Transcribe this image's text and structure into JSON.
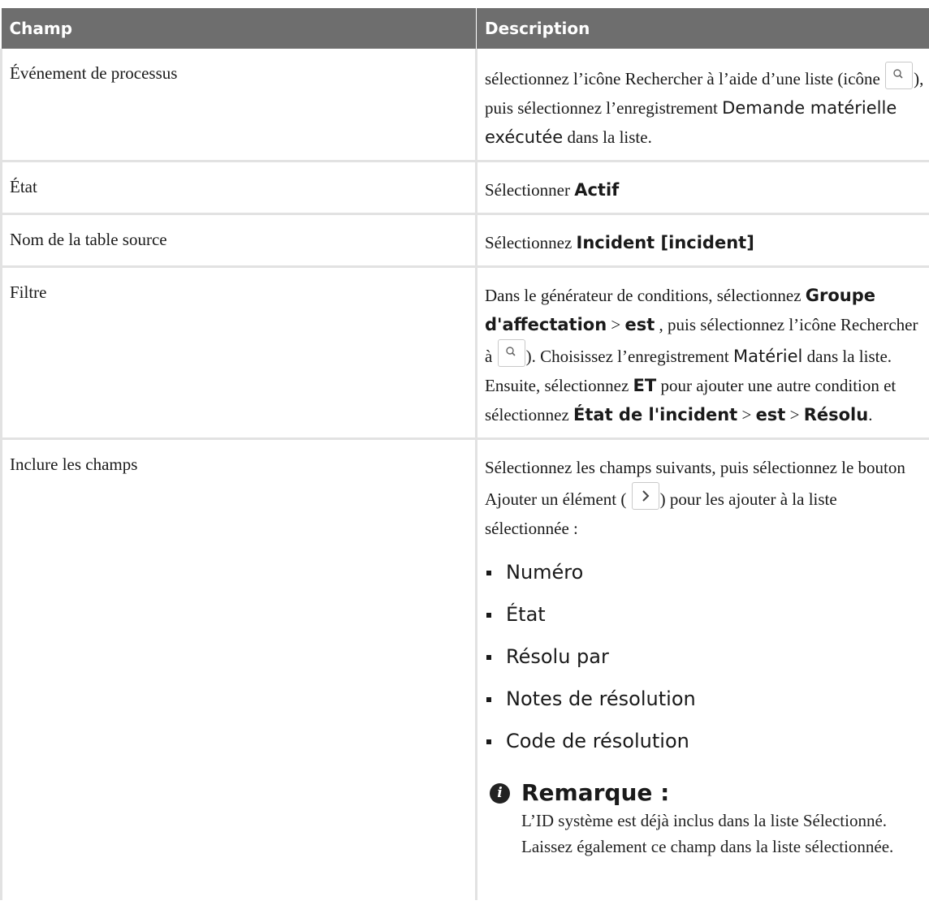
{
  "table": {
    "headers": [
      "Champ",
      "Description"
    ],
    "rows": {
      "process_event": {
        "field": "Événement de processus",
        "d1": "sélectionnez l’icône Rechercher à l’aide d’une liste (icône ",
        "d2": "), puis sélectionnez l’enregistrement ",
        "d3": "Demande matérielle exécutée",
        "d4": " dans la liste."
      },
      "state": {
        "field": "État",
        "d1": "Sélectionner ",
        "d2": "Actif"
      },
      "source_table": {
        "field": "Nom de la table source",
        "d1": "Sélectionnez ",
        "d2": "Incident [incident]"
      },
      "filter": {
        "field": "Filtre",
        "d1": "Dans le générateur de conditions, sélectionnez ",
        "d2": "Groupe d'affectation",
        "d3": " > ",
        "d4": "est",
        "d5": " , puis sélectionnez l’icône Rechercher à ",
        "d6": "). Choisissez l’enregistrement ",
        "d7": "Matériel",
        "d8": " dans la liste. Ensuite, sélectionnez ",
        "d9": "ET",
        "d10": " pour ajouter une autre condition et sélectionnez ",
        "d11": "État de l'incident",
        "d12": " > ",
        "d13": "est",
        "d14": " > ",
        "d15": "Résolu",
        "d16": "."
      },
      "include_fields": {
        "field": "Inclure les champs",
        "d1": "Sélectionnez les champs suivants, puis sélectionnez le bouton Ajouter un élément ( ",
        "d2": ") pour les ajouter à la liste sélectionnée :",
        "items": [
          "Numéro",
          "État",
          "Résolu par",
          "Notes de résolution",
          "Code de résolution"
        ],
        "note_title": "Remarque :",
        "note_body": "L’ID système est déjà inclus dans la liste Sélectionné. Laissez également ce champ dans la liste sélectionnée."
      }
    }
  },
  "icons": {
    "search": "search-icon",
    "add_item": "chevron-right-icon",
    "note": "info-icon"
  }
}
